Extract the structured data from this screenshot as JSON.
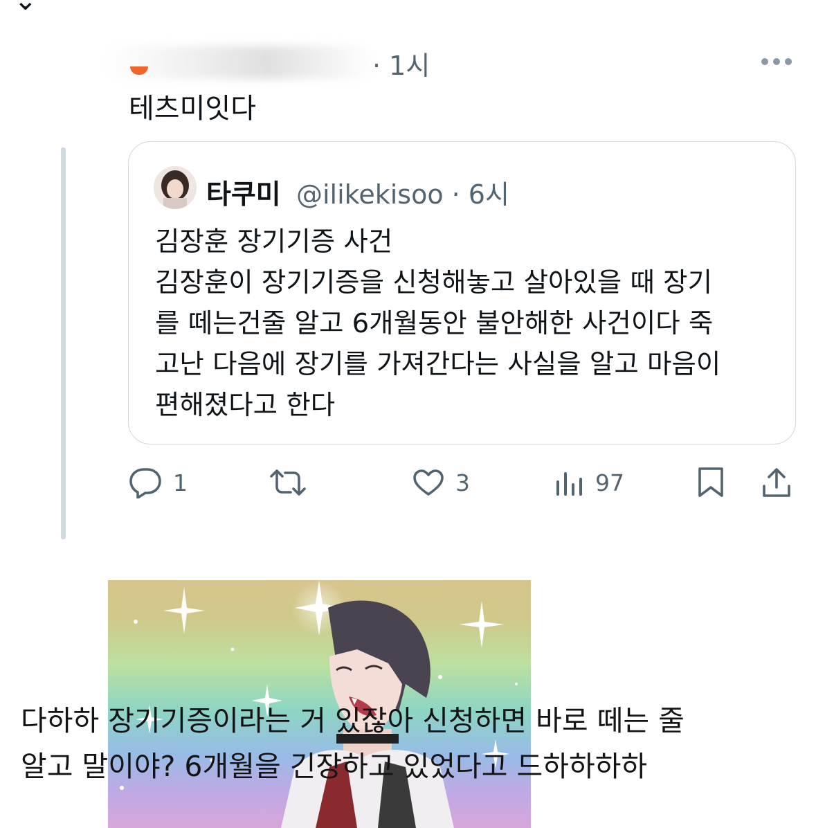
{
  "header": {
    "back_icon": "chevron-down-icon"
  },
  "reply": {
    "time": "· 1시",
    "text": "테츠미잇다"
  },
  "quote": {
    "name": "타쿠미",
    "handle_time": "@ilikekisoo · 6시",
    "lines": [
      "김장훈 장기기증 사건",
      "김장훈이 장기기증을 신청해놓고 살아있을 때 장기",
      "를 떼는건줄 알고 6개월동안 불안해한 사건이다 죽",
      "고난 다음에 장기를 가져간다는 사실을 알고 마음이",
      "편해졌다고 한다"
    ]
  },
  "actions": {
    "reply_count": "1",
    "retweet_count": "",
    "like_count": "3",
    "views_count": "97"
  },
  "overlay_caption": {
    "lines": [
      "다하하 장기기증이라는 거 있잖아 신청하면 바로 떼는 줄",
      "알고 말이야? 6개월을 긴장하고 있었다고 드하하하하"
    ]
  },
  "colors": {
    "text": "#0f1419",
    "muted": "#536471",
    "border": "#cfd9de"
  }
}
